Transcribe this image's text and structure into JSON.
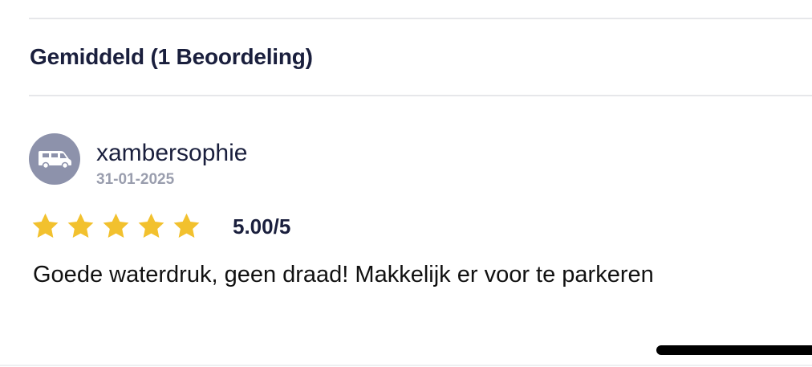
{
  "reviews_section": {
    "heading": "Gemiddeld (1 Beoordeling)",
    "review": {
      "author": "xambersophie",
      "date": "31-01-2025",
      "avatar_icon": "campervan-icon",
      "rating": 5,
      "rating_max": 5,
      "rating_label": "5.00/5",
      "text": "Goede waterdruk, geen draad! Makkelijk er voor te parkeren"
    }
  },
  "colors": {
    "star": "#f2c12e",
    "avatar_bg": "#8d92ab",
    "heading": "#1a1f3d",
    "date": "#9a9eae"
  }
}
